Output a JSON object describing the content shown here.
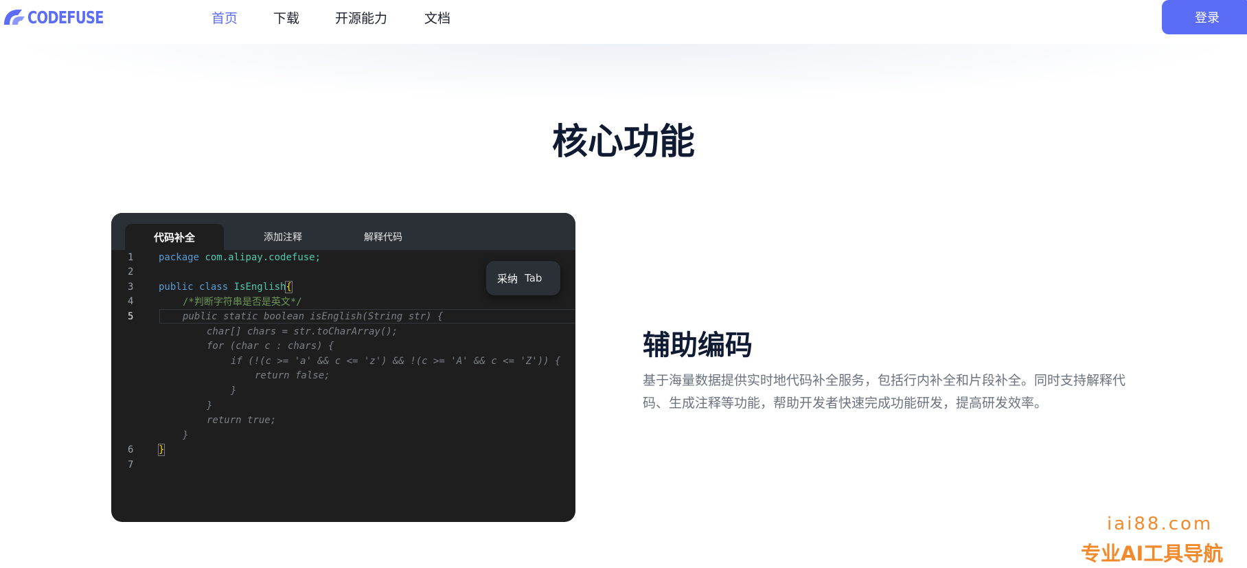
{
  "header": {
    "logo_text": "CODEFUSE",
    "nav": [
      "首页",
      "下载",
      "开源能力",
      "文档"
    ],
    "login_label": "登录",
    "accent_color": "#5b6cf5"
  },
  "section": {
    "title": "核心功能"
  },
  "code_panel": {
    "tabs": [
      "代码补全",
      "添加注释",
      "解释代码"
    ],
    "active_tab": "代码补全",
    "line_numbers": [
      "1",
      "2",
      "3",
      "4",
      "5",
      "6",
      "7"
    ],
    "lines": {
      "l1_kw": "package",
      "l1_rest": "com.alipay.codefuse;",
      "l3_kw": "public class",
      "l3_name": "IsEnglish",
      "l3_brace": "{",
      "l4_comment": "/*判断字符串是否是英文*/",
      "g1": "public static boolean isEnglish(String str) {",
      "g2": "char[] chars = str.toCharArray();",
      "g3": "for (char c : chars) {",
      "g4": "if (!(c >= 'a' && c <= 'z') && !(c >= 'A' && c <= 'Z')) {",
      "g5": "return false;",
      "g6": "}",
      "g7": "}",
      "g8": "return true;",
      "g9": "}",
      "l6_brace": "}"
    },
    "accept_popup": {
      "label": "采纳",
      "key": "Tab"
    }
  },
  "feature": {
    "title": "辅助编码",
    "description": "基于海量数据提供实时地代码补全服务，包括行内补全和片段补全。同时支持解释代码、生成注释等功能，帮助开发者快速完成功能研发，提高研发效率。"
  },
  "watermark": {
    "line1": "iai88.com",
    "line2": "专业AI工具导航"
  }
}
